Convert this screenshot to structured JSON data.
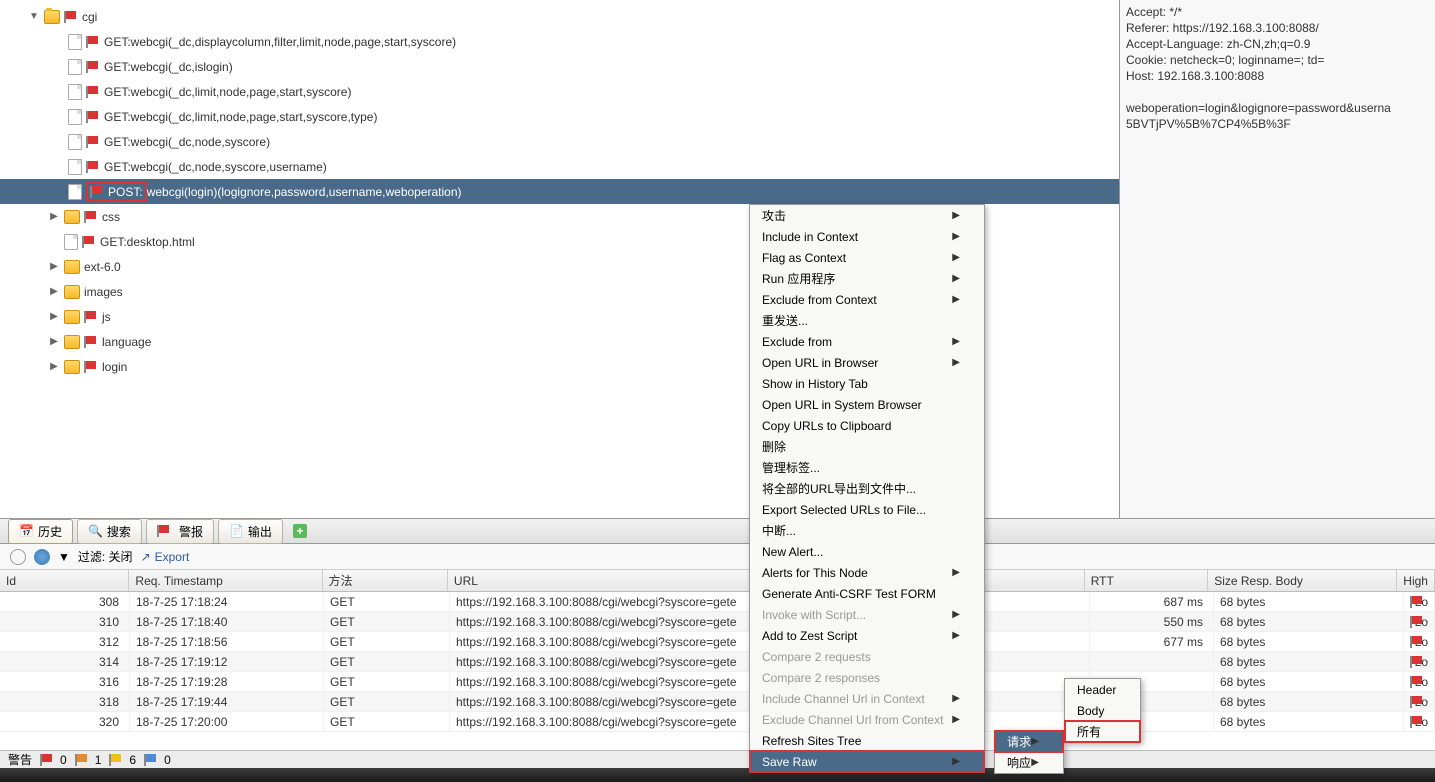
{
  "tree": {
    "cgi": "cgi",
    "items": [
      "GET:webcgi(_dc,displaycolumn,filter,limit,node,page,start,syscore)",
      "GET:webcgi(_dc,islogin)",
      "GET:webcgi(_dc,limit,node,page,start,syscore)",
      "GET:webcgi(_dc,limit,node,page,start,syscore,type)",
      "GET:webcgi(_dc,node,syscore)",
      "GET:webcgi(_dc,node,syscore,username)"
    ],
    "selected_prefix": "POST:",
    "selected_rest": "webcgi(login)(logignore,password,username,weboperation)",
    "folders": [
      "css",
      "ext-6.0",
      "images",
      "js",
      "language",
      "login"
    ],
    "file": "GET:desktop.html"
  },
  "headers": {
    "l1": "Accept: */*",
    "l2": "Referer: https://192.168.3.100:8088/",
    "l3": "Accept-Language: zh-CN,zh;q=0.9",
    "l4": "Cookie: netcheck=0; loginname=; td=",
    "l5": "Host: 192.168.3.100:8088",
    "l6": "",
    "l7": "weboperation=login&logignore=password&userna",
    "l8": "5BVTjPV%5B%7CP4%5B%3F"
  },
  "tabs": {
    "history": "历史",
    "search": "搜索",
    "alerts": "警报",
    "output": "输出"
  },
  "filter": {
    "label": "过滤: 关闭",
    "export": "Export"
  },
  "table": {
    "headers": {
      "id": "Id",
      "ts": "Req. Timestamp",
      "method": "方法",
      "url": "URL",
      "rtt": "RTT",
      "size": "Size Resp. Body",
      "high": "High"
    },
    "rows": [
      {
        "id": "308",
        "ts": "18-7-25 17:18:24",
        "method": "GET",
        "url": "https://192.168.3.100:8088/cgi/webcgi?syscore=gete",
        "rtt": "687 ms",
        "size": "68 bytes",
        "high": "Lo"
      },
      {
        "id": "310",
        "ts": "18-7-25 17:18:40",
        "method": "GET",
        "url": "https://192.168.3.100:8088/cgi/webcgi?syscore=gete",
        "rtt": "550 ms",
        "size": "68 bytes",
        "high": "Lo"
      },
      {
        "id": "312",
        "ts": "18-7-25 17:18:56",
        "method": "GET",
        "url": "https://192.168.3.100:8088/cgi/webcgi?syscore=gete",
        "rtt": "677 ms",
        "size": "68 bytes",
        "high": "Lo"
      },
      {
        "id": "314",
        "ts": "18-7-25 17:19:12",
        "method": "GET",
        "url": "https://192.168.3.100:8088/cgi/webcgi?syscore=gete",
        "rtt": "",
        "size": "68 bytes",
        "high": "Lo"
      },
      {
        "id": "316",
        "ts": "18-7-25 17:19:28",
        "method": "GET",
        "url": "https://192.168.3.100:8088/cgi/webcgi?syscore=gete",
        "rtt": "",
        "size": "68 bytes",
        "high": "Lo"
      },
      {
        "id": "318",
        "ts": "18-7-25 17:19:44",
        "method": "GET",
        "url": "https://192.168.3.100:8088/cgi/webcgi?syscore=gete",
        "rtt": "",
        "size": "68 bytes",
        "high": "Lo"
      },
      {
        "id": "320",
        "ts": "18-7-25 17:20:00",
        "method": "GET",
        "url": "https://192.168.3.100:8088/cgi/webcgi?syscore=gete",
        "rtt": "",
        "size": "68 bytes",
        "high": "Lo"
      }
    ]
  },
  "menu": {
    "items": [
      {
        "label": "攻击",
        "arrow": true
      },
      {
        "label": "Include in Context",
        "arrow": true
      },
      {
        "label": "Flag as Context",
        "arrow": true
      },
      {
        "label": "Run 应用程序",
        "arrow": true
      },
      {
        "label": "Exclude from Context",
        "arrow": true
      },
      {
        "label": "重发送..."
      },
      {
        "label": "Exclude from",
        "arrow": true
      },
      {
        "label": "Open URL in Browser",
        "arrow": true
      },
      {
        "label": "Show in History Tab"
      },
      {
        "label": "Open URL in System Browser"
      },
      {
        "label": "Copy URLs to Clipboard"
      },
      {
        "label": "删除"
      },
      {
        "label": "管理标签..."
      },
      {
        "label": "将全部的URL导出到文件中..."
      },
      {
        "label": "Export Selected URLs to File..."
      },
      {
        "label": "中断..."
      },
      {
        "label": "New Alert..."
      },
      {
        "label": "Alerts for This Node",
        "arrow": true
      },
      {
        "label": "Generate Anti-CSRF Test FORM"
      },
      {
        "label": "Invoke with Script...",
        "disabled": true,
        "arrow": true
      },
      {
        "label": "Add to Zest Script",
        "arrow": true
      },
      {
        "label": "Compare 2 requests",
        "disabled": true
      },
      {
        "label": "Compare 2 responses",
        "disabled": true
      },
      {
        "label": "Include Channel Url in Context",
        "disabled": true,
        "arrow": true
      },
      {
        "label": "Exclude Channel Url from Context",
        "disabled": true,
        "arrow": true
      },
      {
        "label": "Refresh Sites Tree"
      },
      {
        "label": "Save Raw",
        "arrow": true,
        "selected": true,
        "red": true
      }
    ],
    "sub2": {
      "request": "请求",
      "response": "响应"
    },
    "sub3": {
      "header": "Header",
      "body": "Body",
      "all": "所有"
    }
  },
  "status": {
    "warn": "警告",
    "c1": "0",
    "c2": "1",
    "c3": "6",
    "c4": "0"
  }
}
